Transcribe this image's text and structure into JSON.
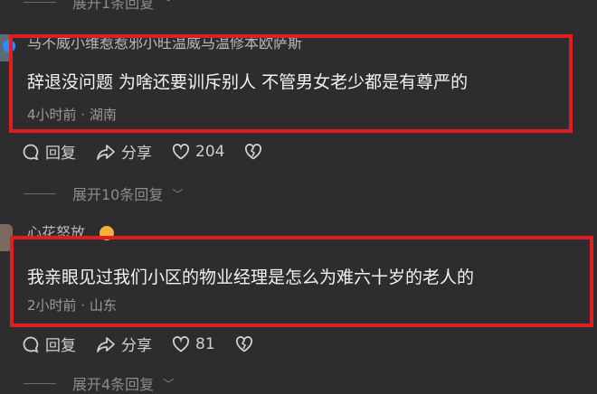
{
  "top_reply_toggle": "展开1条回复",
  "comments": [
    {
      "username": "马不威小维惹惹邪小旺温威马温修本欧萨斯",
      "text": "辞退没问题 为啥还要训斥别人 不管男女老少都是有尊严的",
      "time_location": "4小时前 · 湖南",
      "reply_label": "回复",
      "share_label": "分享",
      "like_count": "204",
      "replies_toggle": "展开10条回复"
    },
    {
      "username": "心花怒放",
      "text": "我亲眼见过我们小区的物业经理是怎么为难六十岁的老人的",
      "time_location": "2小时前 · 山东",
      "reply_label": "回复",
      "share_label": "分享",
      "like_count": "81",
      "replies_toggle": "展开4条回复"
    }
  ],
  "colors": {
    "background": "#2d2d30",
    "highlight_box": "#e21d1d",
    "verified_badge": "#2a8cff"
  }
}
